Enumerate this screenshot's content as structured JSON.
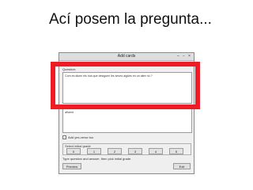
{
  "slide": {
    "title": "Ací posem la pregunta..."
  },
  "window": {
    "title": "Add cards",
    "controls": [
      "–",
      "−",
      "×"
    ],
    "category_label": "Category / Subject:",
    "question_label": "Question:",
    "question_text": "Com es diuen els rius que desiguen les seves aigües en un altre riu ?",
    "answer_label": "Answer:",
    "answer_text": "afluent",
    "add_reverse_label": "Add yes-verse too",
    "grade_group_label": "Select initial grade",
    "grades": [
      "0",
      "1",
      "2",
      "3",
      "4",
      "5"
    ],
    "hint": "Type question and answer, then pick initial grade.",
    "preview_label": "Preview",
    "exit_label": "Exit"
  },
  "accent_color": "#ee1c24"
}
